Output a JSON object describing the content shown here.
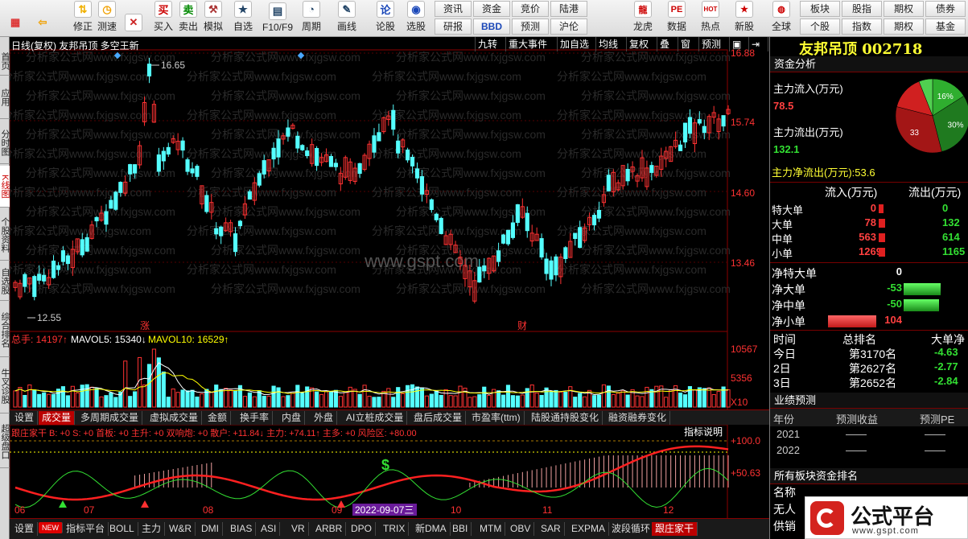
{
  "toolbar": {
    "buttons": [
      {
        "label": "",
        "icon": "grid-icon"
      },
      {
        "label": "",
        "icon": "back-arrow-icon"
      },
      {
        "label": "修正",
        "icon": "up-down-arrow-icon"
      },
      {
        "label": "测速",
        "icon": "speed-icon"
      },
      {
        "label": "",
        "icon": "close-icon"
      },
      {
        "label": "买入",
        "icon": "buy-icon",
        "glyph": "买"
      },
      {
        "label": "卖出",
        "icon": "sell-icon",
        "glyph": "卖"
      },
      {
        "label": "模拟",
        "icon": "gavel-icon"
      },
      {
        "label": "自选",
        "icon": "star-folder-icon"
      },
      {
        "label": "F10/F9",
        "icon": "f10-icon"
      },
      {
        "label": "周期",
        "icon": "clock-icon"
      },
      {
        "label": "画线",
        "icon": "pencil-icon"
      },
      {
        "label": "论股",
        "icon": "discuss-icon",
        "glyph": "论"
      },
      {
        "label": "选股",
        "icon": "pick-stock-icon"
      }
    ],
    "small_buttons_left": [
      [
        "资讯",
        "研报"
      ],
      [
        "资金",
        "BBD"
      ],
      [
        "竞价",
        "预测"
      ],
      [
        "陆港",
        "沪伦"
      ]
    ],
    "right_buttons": [
      {
        "label": "龙虎",
        "icon": "dragon-icon"
      },
      {
        "label": "数据",
        "icon": "pe-icon",
        "glyph": "PE"
      },
      {
        "label": "热点",
        "icon": "hot-icon",
        "glyph": "HOT"
      },
      {
        "label": "新股",
        "icon": "new-stock-icon"
      },
      {
        "label": "全球",
        "icon": "globe-icon"
      }
    ],
    "small_buttons_right": [
      [
        "板块",
        "个股"
      ],
      [
        "股指",
        "指数"
      ],
      [
        "期权",
        "期权"
      ],
      [
        "债券",
        "基金"
      ]
    ]
  },
  "left_strip": [
    "首页",
    "应用",
    "分时图",
    "K线图",
    "个股资料",
    "自选股",
    "综合排名",
    "牛叉诊股",
    "超级盘口"
  ],
  "chart": {
    "title_left": "日线(复权) 友邦吊顶 多空王新",
    "right_buttons": [
      "九转",
      "重大事件",
      "加自选",
      "均线",
      "复权",
      "叠",
      "窗",
      "预测",
      "▣",
      "⇥",
      "▾"
    ],
    "price_labels": [
      "16.88",
      "15.74",
      "14.60",
      "13.46"
    ],
    "high_label": "16.65",
    "low_label": "12.55",
    "markers": [
      "涨",
      "财"
    ],
    "watermark_site": "www.gspt.com",
    "watermark_text": "分析家公式网www.fxjgsw.com",
    "volume_header": {
      "total": "总手: 14197↑",
      "mavol5": "MAVOL5: 15340↓",
      "mavol10": "MAVOL10: 16529↑"
    },
    "volume_labels": [
      "10567",
      "5356",
      "X10"
    ],
    "volume_tabs": [
      "设置",
      "成交量",
      "多周期成交量",
      "虚拟成交量",
      "金额",
      "换手率",
      "内盘",
      "外盘",
      "AI立桩成交量",
      "盘后成交量",
      "市盈率(ttm)",
      "陆股通持股变化",
      "融资融券变化"
    ],
    "indicator_header": "跟庄家干  B: +0  S: +0  首板: +0  主升: +0  双响炮: +0  散户: +11.84↓  主力: +74.11↑  主多: +0  风险区: +80.00",
    "indicator_link": "指标说明",
    "indicator_labels": [
      "+100.0",
      "+50.63"
    ],
    "dates": [
      "06",
      "07",
      "08",
      "09",
      "10",
      "11",
      "12"
    ],
    "cursor_date": "2022-09-07三",
    "bottom_tabs": [
      "设置",
      "NEW",
      "指标平台",
      "BOLL",
      "主力",
      "W&R",
      "DMI",
      "BIAS",
      "ASI",
      "VR",
      "ARBR",
      "DPO",
      "TRIX",
      "新DMA",
      "BBI",
      "MTM",
      "OBV",
      "SAR",
      "EXPMA",
      "波段循环",
      "跟庄家干"
    ]
  },
  "right_panel": {
    "stock_title": "友邦吊顶 002718",
    "section1": "资金分析",
    "main_inflow_label": "主力流入(万元)",
    "main_inflow": "78.5",
    "main_outflow_label": "主力流出(万元)",
    "main_outflow": "132.1",
    "net_outflow": "主力净流出(万元):53.6",
    "pie": [
      {
        "label": "16%",
        "value": 16,
        "color": "#2fae2f"
      },
      {
        "label": "30%",
        "value": 30,
        "color": "#1f7a1f"
      },
      {
        "label": "33",
        "value": 33,
        "color": "#a31616"
      },
      {
        "label": "",
        "value": 15,
        "color": "#d02020"
      },
      {
        "label": "",
        "value": 6,
        "color": "#50d050"
      }
    ],
    "flow_headers": [
      "流入(万元)",
      "流出(万元)"
    ],
    "flow_rows": [
      {
        "name": "特大单",
        "in": "0",
        "out": "0"
      },
      {
        "name": "大单",
        "in": "78",
        "out": "132"
      },
      {
        "name": "中单",
        "in": "563",
        "out": "614"
      },
      {
        "name": "小单",
        "in": "1269",
        "out": "1165"
      }
    ],
    "net_rows": [
      {
        "name": "净特大单",
        "value": "0"
      },
      {
        "name": "净大单",
        "value": "-53"
      },
      {
        "name": "净中单",
        "value": "-50"
      },
      {
        "name": "净小单",
        "value": "104"
      }
    ],
    "rank_headers": [
      "时间",
      "总排名",
      "大单净"
    ],
    "rank_rows": [
      {
        "time": "今日",
        "rank": "第3170名",
        "net": "-4.63"
      },
      {
        "time": "2日",
        "rank": "第2627名",
        "net": "-2.77"
      },
      {
        "time": "3日",
        "rank": "第2652名",
        "net": "-2.84"
      }
    ],
    "section2": "业绩预测",
    "forecast_headers": [
      "年份",
      "预测收益",
      "预测PE"
    ],
    "forecast_rows": [
      {
        "year": "2021",
        "eps": "——",
        "pe": "——"
      },
      {
        "year": "2022",
        "eps": "——",
        "pe": "——"
      }
    ],
    "section3": "所有板块资金排名",
    "sector_rows": [
      "名称",
      "无人",
      "供销"
    ]
  },
  "logo": {
    "text": "公式平台",
    "url": "www.gspt.com"
  },
  "colors": {
    "up": "#ff3232",
    "down": "#54ffff",
    "ma5": "#ffffff",
    "ma10": "#ffff00",
    "indicator_red": "#ff2020",
    "indicator_green": "#33e033"
  }
}
